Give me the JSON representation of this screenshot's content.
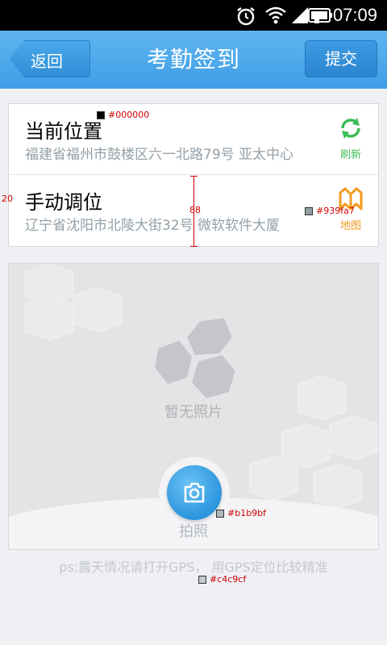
{
  "status_bar": {
    "time": "07:09"
  },
  "header": {
    "back_label": "返回",
    "title": "考勤签到",
    "submit_label": "提交"
  },
  "current_location": {
    "title": "当前位置",
    "address": "福建省福州市鼓楼区六一北路79号 亚太中心",
    "action_label": "刷新"
  },
  "manual_location": {
    "title": "手动调位",
    "address": "辽宁省沈阳市北陵大街32号 微软软件大厦",
    "action_label": "地图"
  },
  "photo": {
    "empty_text": "暂无照片",
    "capture_label": "拍照"
  },
  "hint": "ps:露天情况请打开GPS， 用GPS定位比较精准",
  "annotations": {
    "title_color": "#000000",
    "addr_color": "#939fa7",
    "padding": "20",
    "row_height": "88",
    "cam_color": "#b1b9bf",
    "hint_color": "#c4c9cf"
  },
  "colors": {
    "header": "#3f9ee6",
    "refresh": "#3dbd55",
    "map": "#f29b1f",
    "camera": "#2b95dd"
  },
  "icons": [
    "alarm-icon",
    "wifi-icon",
    "signal-icon",
    "battery-icon",
    "refresh-icon",
    "map-icon",
    "camera-icon"
  ]
}
